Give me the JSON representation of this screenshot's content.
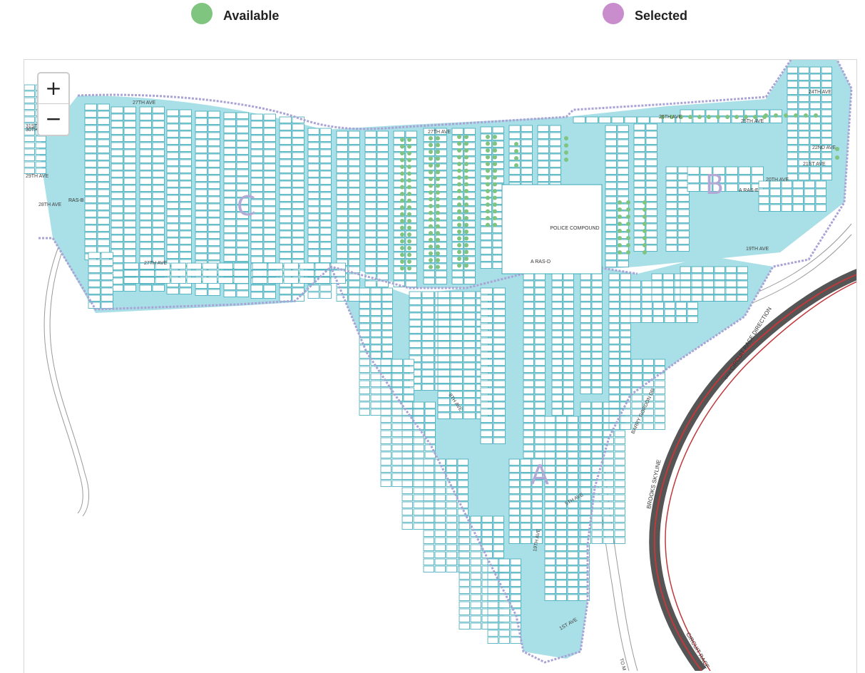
{
  "legend": {
    "available": {
      "label": "Available",
      "color": "#7fc47f"
    },
    "selected": {
      "label": "Selected",
      "color": "#c98ccc"
    }
  },
  "zoom": {
    "in_label": "+",
    "out_label": "−"
  },
  "colors": {
    "plot_fill": "#a9dfe6",
    "plot_stroke": "#3aa8b8",
    "boundary": "#a9a3d6",
    "available_marker": "#7fc47f",
    "track_dark": "#555555",
    "track_red": "#c0393b"
  },
  "map": {
    "section_labels": {
      "a": "A",
      "b": "B",
      "c": "C"
    },
    "police_compound": "POLICE COMPOUND",
    "ras_labels": [
      "A RAS-D",
      "A RAS-E",
      "RAS-B"
    ],
    "streets": {
      "ave_27": "27TH AVE",
      "ave_27_b": "27TH AVE",
      "ave_24": "24TH AVE",
      "ave_26": "26TH AVE",
      "ave_25": "25TH AVE",
      "ave_22": "22ND AVE",
      "ave_21": "21ST AVE",
      "ave_20": "20TH AVE",
      "ave_19": "19TH AVE",
      "ave_19_b": "19TH AVE",
      "ave_28": "28TH AVE",
      "ave_29": "29TH AVE",
      "ave_27_c": "27TH AVE",
      "ave_31": "31ST AVE",
      "ave_30": "30TH AVE",
      "ave_8": "8TH AVE",
      "ave_5": "5TH AVE",
      "ave_1": "1ST AVE",
      "barry_gordon": "BARRY GORDON DR",
      "to_m": "TO M"
    },
    "race": {
      "circuit_direction": "<<< CIRCUIT RACE DIRECTION",
      "brooks_skyline": "BROOKS SKYLINE",
      "circuit_race": "CIRCUIT RACE"
    }
  }
}
